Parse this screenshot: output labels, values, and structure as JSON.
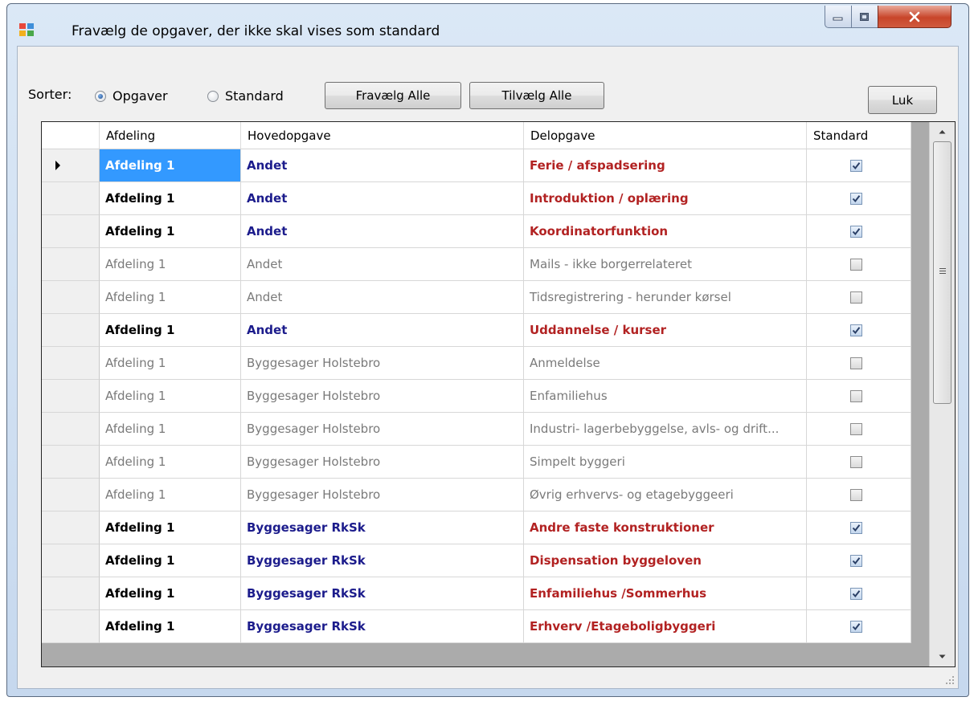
{
  "window": {
    "title": "Fravælg de opgaver, der ikke skal vises som standard",
    "icon": "app-icon"
  },
  "toolbar": {
    "sort_label": "Sorter:",
    "radio_opgaver": "Opgaver",
    "radio_standard": "Standard",
    "selected_sort": "Opgaver",
    "fravaelg_all": "Fravælg Alle",
    "tilvaelg_all": "Tilvælg Alle",
    "close": "Luk"
  },
  "grid": {
    "columns": [
      "Afdeling",
      "Hovedopgave",
      "Delopgave",
      "Standard"
    ],
    "rows": [
      {
        "afdeling": "Afdeling 1",
        "hovedopgave": "Andet",
        "delopgave": "Ferie / afspadsering",
        "standard": true
      },
      {
        "afdeling": "Afdeling 1",
        "hovedopgave": "Andet",
        "delopgave": "Introduktion / oplæring",
        "standard": true
      },
      {
        "afdeling": "Afdeling 1",
        "hovedopgave": "Andet",
        "delopgave": "Koordinatorfunktion",
        "standard": true
      },
      {
        "afdeling": "Afdeling 1",
        "hovedopgave": "Andet",
        "delopgave": "Mails - ikke borgerrelateret",
        "standard": false
      },
      {
        "afdeling": "Afdeling 1",
        "hovedopgave": "Andet",
        "delopgave": "Tidsregistrering - herunder kørsel",
        "standard": false
      },
      {
        "afdeling": "Afdeling 1",
        "hovedopgave": "Andet",
        "delopgave": "Uddannelse / kurser",
        "standard": true
      },
      {
        "afdeling": "Afdeling 1",
        "hovedopgave": "Byggesager Holstebro",
        "delopgave": "Anmeldelse",
        "standard": false
      },
      {
        "afdeling": "Afdeling 1",
        "hovedopgave": "Byggesager Holstebro",
        "delopgave": "Enfamiliehus",
        "standard": false
      },
      {
        "afdeling": "Afdeling 1",
        "hovedopgave": "Byggesager Holstebro",
        "delopgave": "Industri- lagerbebyggelse, avls- og drift...",
        "standard": false
      },
      {
        "afdeling": "Afdeling 1",
        "hovedopgave": "Byggesager Holstebro",
        "delopgave": "Simpelt byggeri",
        "standard": false
      },
      {
        "afdeling": "Afdeling 1",
        "hovedopgave": "Byggesager Holstebro",
        "delopgave": "Øvrig erhvervs- og etagebyggeeri",
        "standard": false
      },
      {
        "afdeling": "Afdeling 1",
        "hovedopgave": "Byggesager RkSk",
        "delopgave": "Andre faste konstruktioner",
        "standard": true
      },
      {
        "afdeling": "Afdeling 1",
        "hovedopgave": "Byggesager RkSk",
        "delopgave": "Dispensation byggeloven",
        "standard": true
      },
      {
        "afdeling": "Afdeling 1",
        "hovedopgave": "Byggesager RkSk",
        "delopgave": "Enfamiliehus /Sommerhus",
        "standard": true
      },
      {
        "afdeling": "Afdeling 1",
        "hovedopgave": "Byggesager RkSk",
        "delopgave": "Erhverv /Etageboligbyggeri",
        "standard": true
      }
    ]
  },
  "colors": {
    "selected_cell": "#3399ff",
    "hovedopgave_bold": "#1c1c8c",
    "delopgave_bold": "#b22222",
    "inactive_text": "#7a7a7a"
  }
}
